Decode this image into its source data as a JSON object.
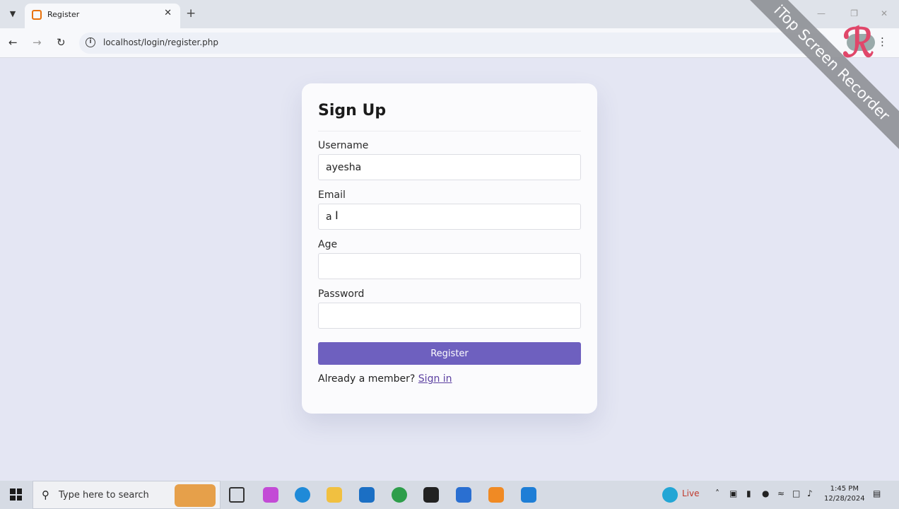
{
  "browser": {
    "tab_title": "Register",
    "url": "localhost/login/register.php"
  },
  "watermark": {
    "text": "iTop Screen Recorder"
  },
  "form": {
    "title": "Sign Up",
    "username": {
      "label": "Username",
      "value": "ayesha"
    },
    "email": {
      "label": "Email",
      "value": "a"
    },
    "age": {
      "label": "Age",
      "value": ""
    },
    "password": {
      "label": "Password",
      "value": ""
    },
    "submit_label": "Register",
    "member_text": "Already a member?",
    "signin_label": "Sign in"
  },
  "taskbar": {
    "search_placeholder": "Type here to search",
    "weather_label": "Live",
    "time": "1:45 PM",
    "date": "12/28/2024"
  },
  "colors": {
    "accent": "#6e60bf",
    "background": "#e4e6f3",
    "card": "#fbfbfd"
  }
}
